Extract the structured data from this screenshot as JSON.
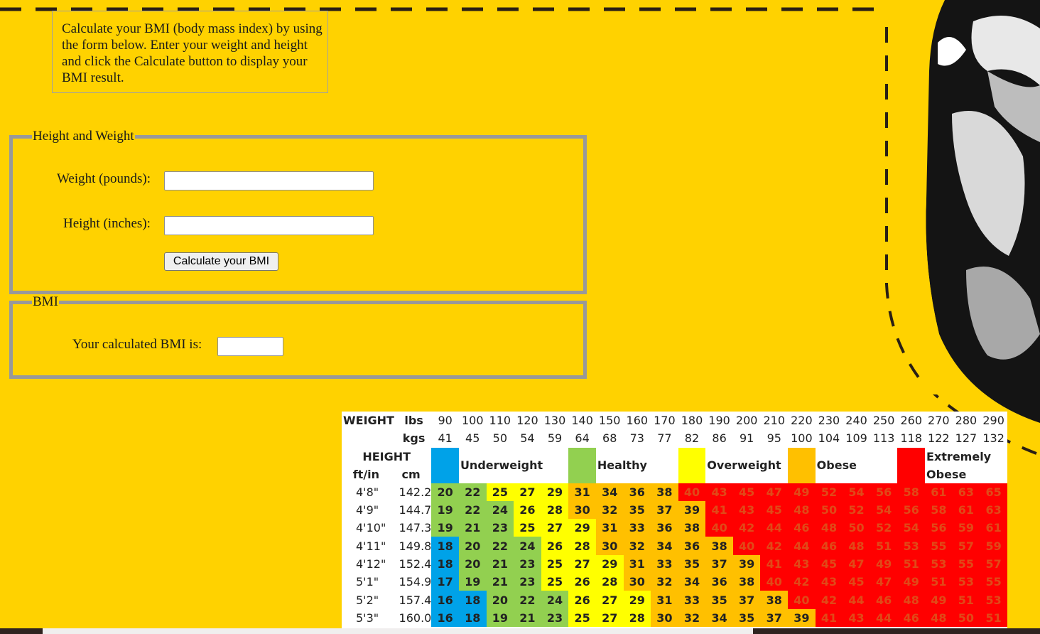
{
  "intro": {
    "text": "Calculate your BMI (body mass index) by using the form below. Enter your weight and height and click the Calculate button to display your BMI result."
  },
  "form": {
    "legend": "Height and Weight",
    "weight_label": "Weight (pounds):",
    "weight_value": "",
    "height_label": "Height (inches):",
    "height_value": "",
    "calculate_label": "Calculate your BMI"
  },
  "result": {
    "legend": "BMI",
    "label": "Your calculated BMI is:",
    "value": ""
  },
  "chart_data": {
    "type": "table",
    "weight_label": "WEIGHT",
    "lbs_label": "lbs",
    "kgs_label": "kgs",
    "height_label": "HEIGHT",
    "ftin_label": "ft/in",
    "cm_label": "cm",
    "lbs": [
      "90",
      "100",
      "110",
      "120",
      "130",
      "140",
      "150",
      "160",
      "170",
      "180",
      "190",
      "200",
      "210",
      "220",
      "230",
      "240",
      "250",
      "260",
      "270",
      "280",
      "290"
    ],
    "kgs": [
      "41",
      "45",
      "50",
      "54",
      "59",
      "64",
      "68",
      "73",
      "77",
      "82",
      "86",
      "91",
      "95",
      "100",
      "104",
      "109",
      "113",
      "118",
      "122",
      "127",
      "132"
    ],
    "categories": [
      {
        "name": "Underweight",
        "color": "#00a2e8"
      },
      {
        "name": "Healthy",
        "color": "#92d050"
      },
      {
        "name": "Overweight",
        "color": "#ffff00"
      },
      {
        "name": "Obese",
        "color": "#ffc000"
      },
      {
        "name": "Extremely Obese",
        "color": "#ff0000"
      }
    ],
    "rows": [
      {
        "ftin": "4'8\"",
        "cm": "142.2",
        "bmi": [
          20,
          22,
          25,
          27,
          29,
          31,
          34,
          36,
          38,
          40,
          43,
          45,
          47,
          49,
          52,
          54,
          56,
          58,
          61,
          63,
          65
        ]
      },
      {
        "ftin": "4'9\"",
        "cm": "144.7",
        "bmi": [
          19,
          22,
          24,
          26,
          28,
          30,
          32,
          35,
          37,
          39,
          41,
          43,
          45,
          48,
          50,
          52,
          54,
          56,
          58,
          61,
          63
        ]
      },
      {
        "ftin": "4'10\"",
        "cm": "147.3",
        "bmi": [
          19,
          21,
          23,
          25,
          27,
          29,
          31,
          33,
          36,
          38,
          40,
          42,
          44,
          46,
          48,
          50,
          52,
          54,
          56,
          59,
          61
        ]
      },
      {
        "ftin": "4'11\"",
        "cm": "149.8",
        "bmi": [
          18,
          20,
          22,
          24,
          26,
          28,
          30,
          32,
          34,
          36,
          38,
          40,
          42,
          44,
          46,
          48,
          51,
          53,
          55,
          57,
          59
        ]
      },
      {
        "ftin": "4'12\"",
        "cm": "152.4",
        "bmi": [
          18,
          20,
          21,
          23,
          25,
          27,
          29,
          31,
          33,
          35,
          37,
          39,
          41,
          43,
          45,
          47,
          49,
          51,
          53,
          55,
          57
        ]
      },
      {
        "ftin": "5'1\"",
        "cm": "154.9",
        "bmi": [
          17,
          19,
          21,
          23,
          25,
          26,
          28,
          30,
          32,
          34,
          36,
          38,
          40,
          42,
          43,
          45,
          47,
          49,
          51,
          53,
          55
        ]
      },
      {
        "ftin": "5'2\"",
        "cm": "157.4",
        "bmi": [
          16,
          18,
          20,
          22,
          24,
          26,
          27,
          29,
          31,
          33,
          35,
          37,
          38,
          40,
          42,
          44,
          46,
          48,
          49,
          51,
          53
        ]
      },
      {
        "ftin": "5'3\"",
        "cm": "160.0",
        "bmi": [
          16,
          18,
          19,
          21,
          23,
          25,
          27,
          28,
          30,
          32,
          34,
          35,
          37,
          39,
          41,
          43,
          44,
          46,
          48,
          50,
          51
        ]
      }
    ]
  }
}
